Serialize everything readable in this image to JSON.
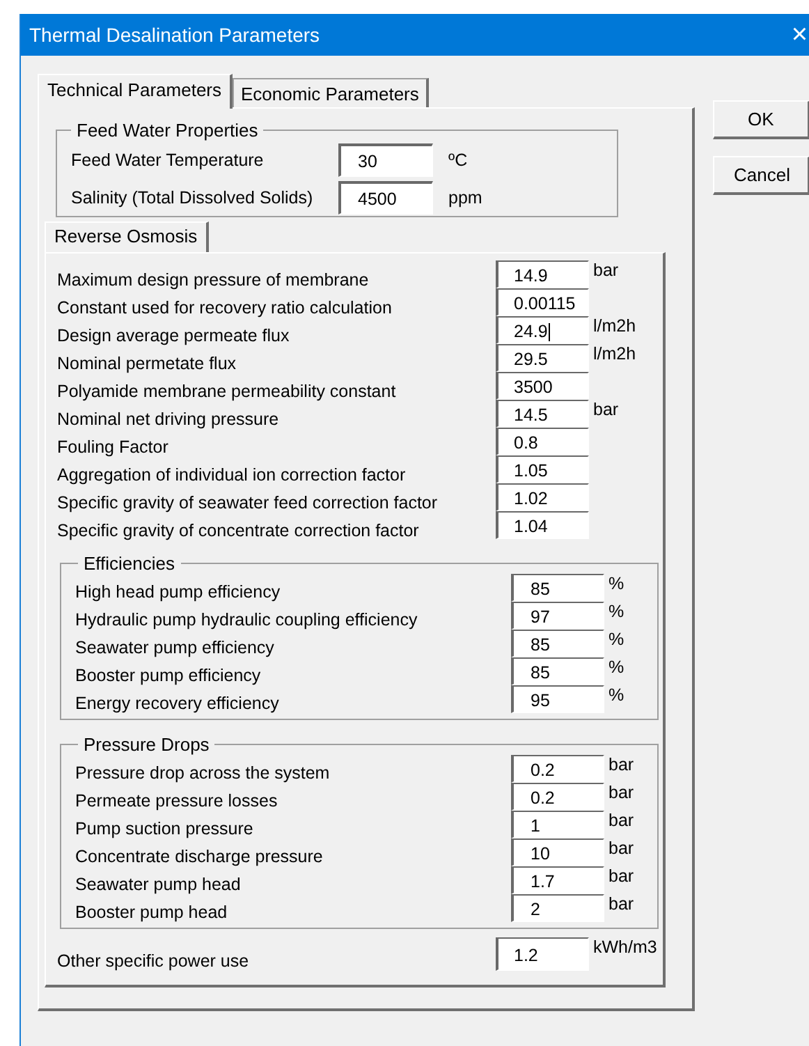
{
  "window": {
    "title": "Thermal Desalination Parameters",
    "close": "×"
  },
  "tabs": [
    {
      "label": "Technical Parameters",
      "selected": true
    },
    {
      "label": "Economic Parameters",
      "selected": false
    }
  ],
  "buttons": [
    "OK",
    "Cancel"
  ],
  "feed_water": {
    "title": "Feed Water Properties",
    "fields": [
      {
        "label": "Feed Water Temperature",
        "value": "30",
        "unit": "ºC"
      },
      {
        "label": "Salinity (Total Dissolved Solids)",
        "value": "4500",
        "unit": "ppm"
      }
    ]
  },
  "subtabs": [
    "Reverse Osmosis"
  ],
  "reverse_osmosis": [
    {
      "label": "Maximum design pressure of membrane",
      "value": "14.9",
      "unit": "bar",
      "focused": false
    },
    {
      "label": "Constant used for recovery ratio calculation",
      "value": "0.00115",
      "focused": false
    },
    {
      "label": "Design average permeate flux",
      "value": "24.9",
      "unit": "l/m2h",
      "focused": true
    },
    {
      "label": "Nominal permetate flux",
      "value": "29.5",
      "unit": "l/m2h",
      "focused": false
    },
    {
      "label": "Polyamide membrane permeability constant",
      "value": "3500",
      "focused": false
    },
    {
      "label": "Nominal net driving pressure",
      "value": "14.5",
      "unit": "bar",
      "focused": false
    },
    {
      "label": "Fouling Factor",
      "value": "0.8",
      "focused": false
    },
    {
      "label": "Aggregation of individual ion correction factor",
      "value": "1.05",
      "focused": false
    },
    {
      "label": "Specific gravity of seawater feed correction factor",
      "value": "1.02",
      "focused": false
    },
    {
      "label": "Specific gravity of concentrate correction factor",
      "value": "1.04",
      "focused": false
    }
  ],
  "efficiencies": {
    "title": "Efficiencies",
    "fields": [
      {
        "label": "High head pump efficiency",
        "value": "85",
        "unit": "%"
      },
      {
        "label": "Hydraulic pump hydraulic coupling efficiency",
        "value": "97",
        "unit": "%"
      },
      {
        "label": "Seawater pump efficiency",
        "value": "85",
        "unit": "%"
      },
      {
        "label": "Booster pump efficiency",
        "value": "85",
        "unit": "%"
      },
      {
        "label": "Energy recovery efficiency",
        "value": "95",
        "unit": "%"
      }
    ]
  },
  "pressure_drops": {
    "title": "Pressure Drops",
    "fields": [
      {
        "label": "Pressure drop across the system",
        "value": "0.2",
        "unit": "bar"
      },
      {
        "label": "Permeate pressure losses",
        "value": "0.2",
        "unit": "bar"
      },
      {
        "label": "Pump suction pressure",
        "value": "1",
        "unit": "bar"
      },
      {
        "label": "Concentrate discharge pressure",
        "value": "10",
        "unit": "bar"
      },
      {
        "label": "Seawater pump head",
        "value": "1.7",
        "unit": "bar"
      },
      {
        "label": "Booster pump head",
        "value": "2",
        "unit": "bar"
      }
    ]
  },
  "other": {
    "label": "Other specific power use",
    "value": "1.2",
    "unit": "kWh/m3"
  }
}
